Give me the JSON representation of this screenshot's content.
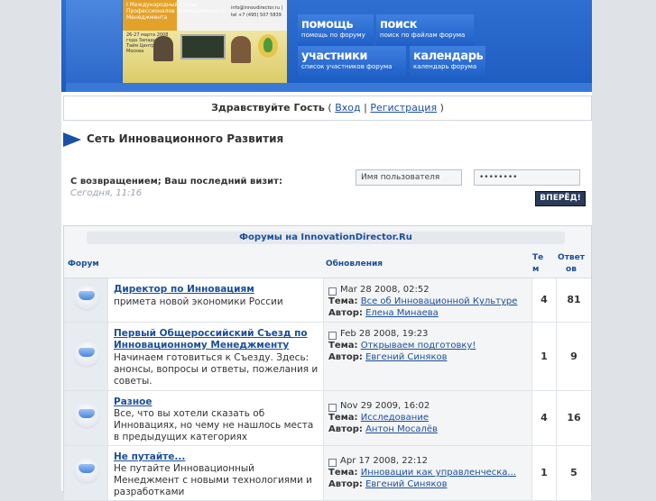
{
  "header": {
    "banner_title": "I Международный Съезд Профессионалов Инновационного Менеджмента",
    "banner_contacts": "info@innovdirector.ru | tel +7 (495) 507 5839",
    "banner_photo_caption": "26-27 марта 2008 года Западный Тайм Центр, Москва",
    "nav": [
      {
        "title": "помощь",
        "sub": "помощь по форуму"
      },
      {
        "title": "поиск",
        "sub": "поиск по файлам форума"
      },
      {
        "title": "участники",
        "sub": "список участников форума"
      },
      {
        "title": "календарь",
        "sub": "календарь форума"
      }
    ]
  },
  "greeting": {
    "text": "Здравствуйте Гость",
    "login": "Вход",
    "separator": "|",
    "register": "Регистрация",
    "open_paren": "(",
    "close_paren": ")"
  },
  "site_title": "Сеть Инновационного Развития",
  "welcome": {
    "label": "С возвращением; Ваш последний визит:",
    "date": "Сегодня, 11:16"
  },
  "login_form": {
    "username_value": "Имя пользователя",
    "password_value": "••••••••",
    "submit_label": "ВПЕРЁД!"
  },
  "forums": {
    "caption": "Форумы на InnovationDirector.Ru",
    "columns": {
      "forum": "Форум",
      "updates": "Обновления",
      "topics": "Тем",
      "replies": "Ответов"
    },
    "topic_label": "Тема:",
    "author_label": "Автор:",
    "rows": [
      {
        "title": "Директор по Инновациям",
        "desc": "примета новой экономики России",
        "date": "Mar 28 2008, 02:52",
        "topic": "Все об Инновационной Культуре",
        "author": "Елена Минаева",
        "topics": "4",
        "replies": "81"
      },
      {
        "title": "Первый Общероссийский Съезд по Инновационному Менеджменту",
        "desc": "Начинаем готовиться к Съезду. Здесь: анонсы, вопросы и ответы, пожелания и советы.",
        "date": "Feb 28 2008, 19:23",
        "topic": "Открываем подготовку!",
        "author": "Евгений Синяков",
        "topics": "1",
        "replies": "9"
      },
      {
        "title": "Разное",
        "desc": "Все, что вы хотели сказать об Инновациях, но чему не нашлось места в предыдущих категориях",
        "date": "Nov 29 2009, 16:02",
        "topic": "Исследование",
        "author": "Антон Мосалёв",
        "topics": "4",
        "replies": "16"
      },
      {
        "title": "Не путайте...",
        "desc": "Не путайте Инновационный Менеджмент с новыми технологиями и разработками",
        "date": "Apr 17 2008, 22:12",
        "topic": "Инновации как управленческа...",
        "author": "Евгений Синяков",
        "topics": "1",
        "replies": "5"
      }
    ]
  }
}
